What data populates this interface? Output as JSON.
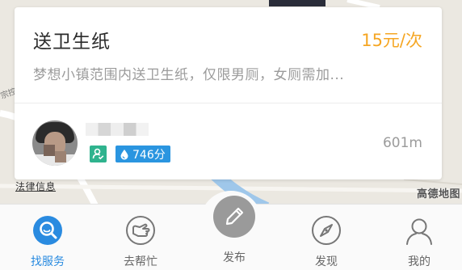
{
  "map": {
    "legal_link": "法律信息",
    "brand": "高德地图",
    "edge_label": "宗控"
  },
  "task_card": {
    "title": "送卫生纸",
    "price": "15元/次",
    "description": "梦想小镇范围内送卫生纸，仅限男厕，女厕需加...",
    "score": "746分",
    "distance": "601m",
    "icons": {
      "certification": "user-verified-icon",
      "score": "water-drop-icon"
    },
    "colors": {
      "price": "#f5a623",
      "certification_badge": "#2fb38e",
      "score_badge": "#2a95e0"
    }
  },
  "tabbar": {
    "tabs": [
      {
        "label": "找服务",
        "icon": "search-service-icon",
        "active": true
      },
      {
        "label": "去帮忙",
        "icon": "helping-hand-icon",
        "active": false
      },
      {
        "label": "发布",
        "icon": "pencil-icon",
        "active": false
      },
      {
        "label": "发现",
        "icon": "compass-icon",
        "active": false
      },
      {
        "label": "我的",
        "icon": "person-icon",
        "active": false
      }
    ],
    "colors": {
      "active": "#2a8be0",
      "inactive": "#666666"
    }
  }
}
